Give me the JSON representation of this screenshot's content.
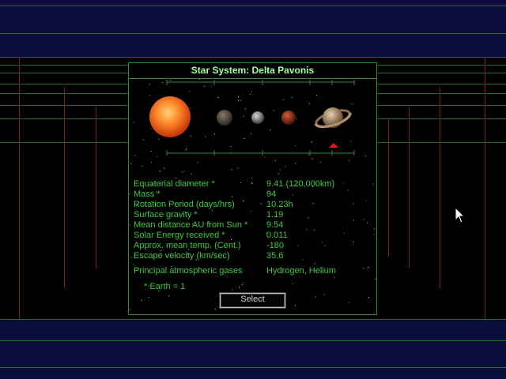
{
  "dialog": {
    "title": "Star System: Delta Pavonis",
    "stats": [
      {
        "label": "Equatorial diameter *",
        "value": "9.41 (120,000km)"
      },
      {
        "label": "Mass *",
        "value": "94"
      },
      {
        "label": "Rotation Period (days/hrs)",
        "value": "10.23h"
      },
      {
        "label": "Surface gravity *",
        "value": "1.19"
      },
      {
        "label": "Mean distance AU from Sun *",
        "value": "9.54"
      },
      {
        "label": "Solar Energy received *",
        "value": "0.011"
      },
      {
        "label": "Approx. mean temp. (Cent.)",
        "value": "-180"
      },
      {
        "label": "Escape velocity (km/sec)",
        "value": "35.6"
      }
    ],
    "atmosphere_label": "Principal atmospheric gases",
    "atmosphere_value": "Hydrogen, Helium",
    "footnote": "* Earth = 1",
    "select_label": "Select"
  },
  "system_view": {
    "bodies": [
      "star-icon",
      "planet-1-icon",
      "planet-2-icon",
      "planet-3-icon",
      "ringed-planet-icon"
    ],
    "selected_body": 5
  },
  "colors": {
    "text": "#3fc83f",
    "title": "#a2ffa0",
    "border": "#2f8a35",
    "band": "#0c0c3c",
    "marker": "#e01818"
  }
}
